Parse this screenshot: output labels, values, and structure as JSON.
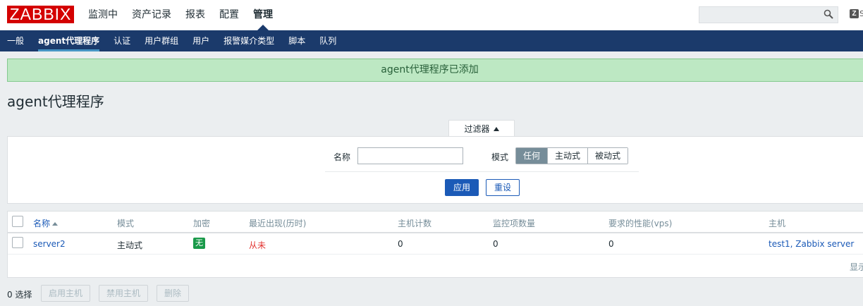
{
  "logo": {
    "text": "ZABBIX"
  },
  "main_menu": [
    {
      "label": "监测中"
    },
    {
      "label": "资产记录"
    },
    {
      "label": "报表"
    },
    {
      "label": "配置"
    },
    {
      "label": "管理",
      "active": true
    }
  ],
  "header": {
    "search_value": "",
    "share_label": "S"
  },
  "sub_menu": [
    {
      "label": "一般"
    },
    {
      "label": "agent代理程序",
      "active": true
    },
    {
      "label": "认证"
    },
    {
      "label": "用户群组"
    },
    {
      "label": "用户"
    },
    {
      "label": "报警媒介类型"
    },
    {
      "label": "脚本"
    },
    {
      "label": "队列"
    }
  ],
  "message": {
    "text": "agent代理程序已添加"
  },
  "page": {
    "title": "agent代理程序"
  },
  "filter": {
    "tab_label": "过滤器",
    "name_label": "名称",
    "name_value": "",
    "mode_label": "模式",
    "mode_options": [
      "任何",
      "主动式",
      "被动式"
    ],
    "mode_selected": "任何",
    "apply_label": "应用",
    "reset_label": "重设"
  },
  "table": {
    "headers": {
      "name": "名称",
      "mode": "模式",
      "encryption": "加密",
      "last_seen": "最近出现(历时)",
      "host_count": "主机计数",
      "item_count": "监控项数量",
      "required_performance": "要求的性能(vps)",
      "hosts": "主机"
    },
    "rows": [
      {
        "name": "server2",
        "mode": "主动式",
        "encryption": "无",
        "last_seen": "从未",
        "host_count": "0",
        "item_count": "0",
        "required_performance": "0",
        "hosts": "test1, Zabbix server"
      }
    ],
    "showing_text": "显示"
  },
  "footer": {
    "selected_text": "0 选择",
    "enable_label": "启用主机",
    "disable_label": "禁用主机",
    "delete_label": "删除"
  },
  "colors": {
    "brand_red": "#d40000",
    "nav_blue": "#1b3a6b",
    "link_blue": "#1b5ab7",
    "success_bg": "#bde8c3",
    "badge_green": "#1a9a4a",
    "never_red": "#e33734"
  }
}
